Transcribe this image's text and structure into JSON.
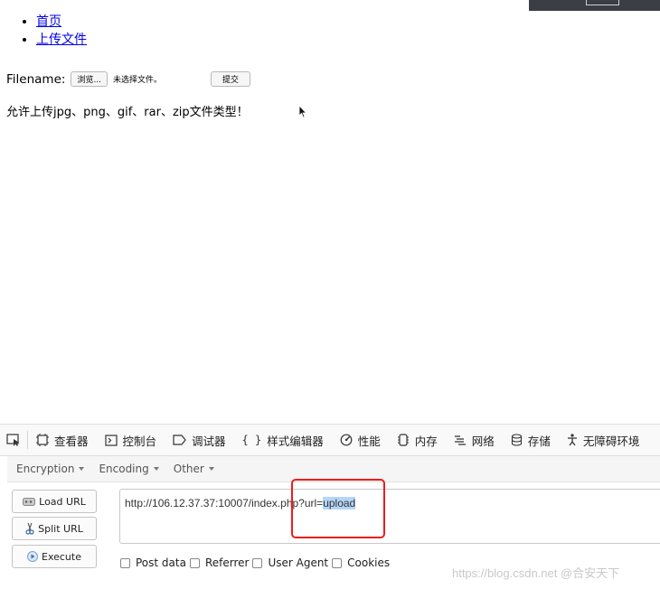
{
  "nav": {
    "items": [
      "首页",
      "上传文件"
    ]
  },
  "form": {
    "label": "Filename:",
    "browse": "浏览...",
    "no_file": "未选择文件。",
    "submit": "提交"
  },
  "message": "允许上传jpg、png、gif、rar、zip文件类型！",
  "devtools": {
    "tabs": [
      "查看器",
      "控制台",
      "调试器",
      "样式编辑器",
      "性能",
      "内存",
      "网络",
      "存储",
      "无障碍环境"
    ]
  },
  "hackbar": {
    "menus": [
      "Encryption",
      "Encoding",
      "Other"
    ],
    "buttons": {
      "load": "Load URL",
      "split": "Split URL",
      "execute": "Execute"
    },
    "url_prefix": "http://106.12.37.37:10007/index.php?url=",
    "url_selected": "upload",
    "options": [
      "Post data",
      "Referrer",
      "User Agent",
      "Cookies"
    ]
  },
  "watermark": "https://blog.csdn.net  @合安天下",
  "colors": {
    "highlight_box": "#ee1c1c",
    "selection": "#b5d5f7",
    "link": "#0000ee"
  }
}
